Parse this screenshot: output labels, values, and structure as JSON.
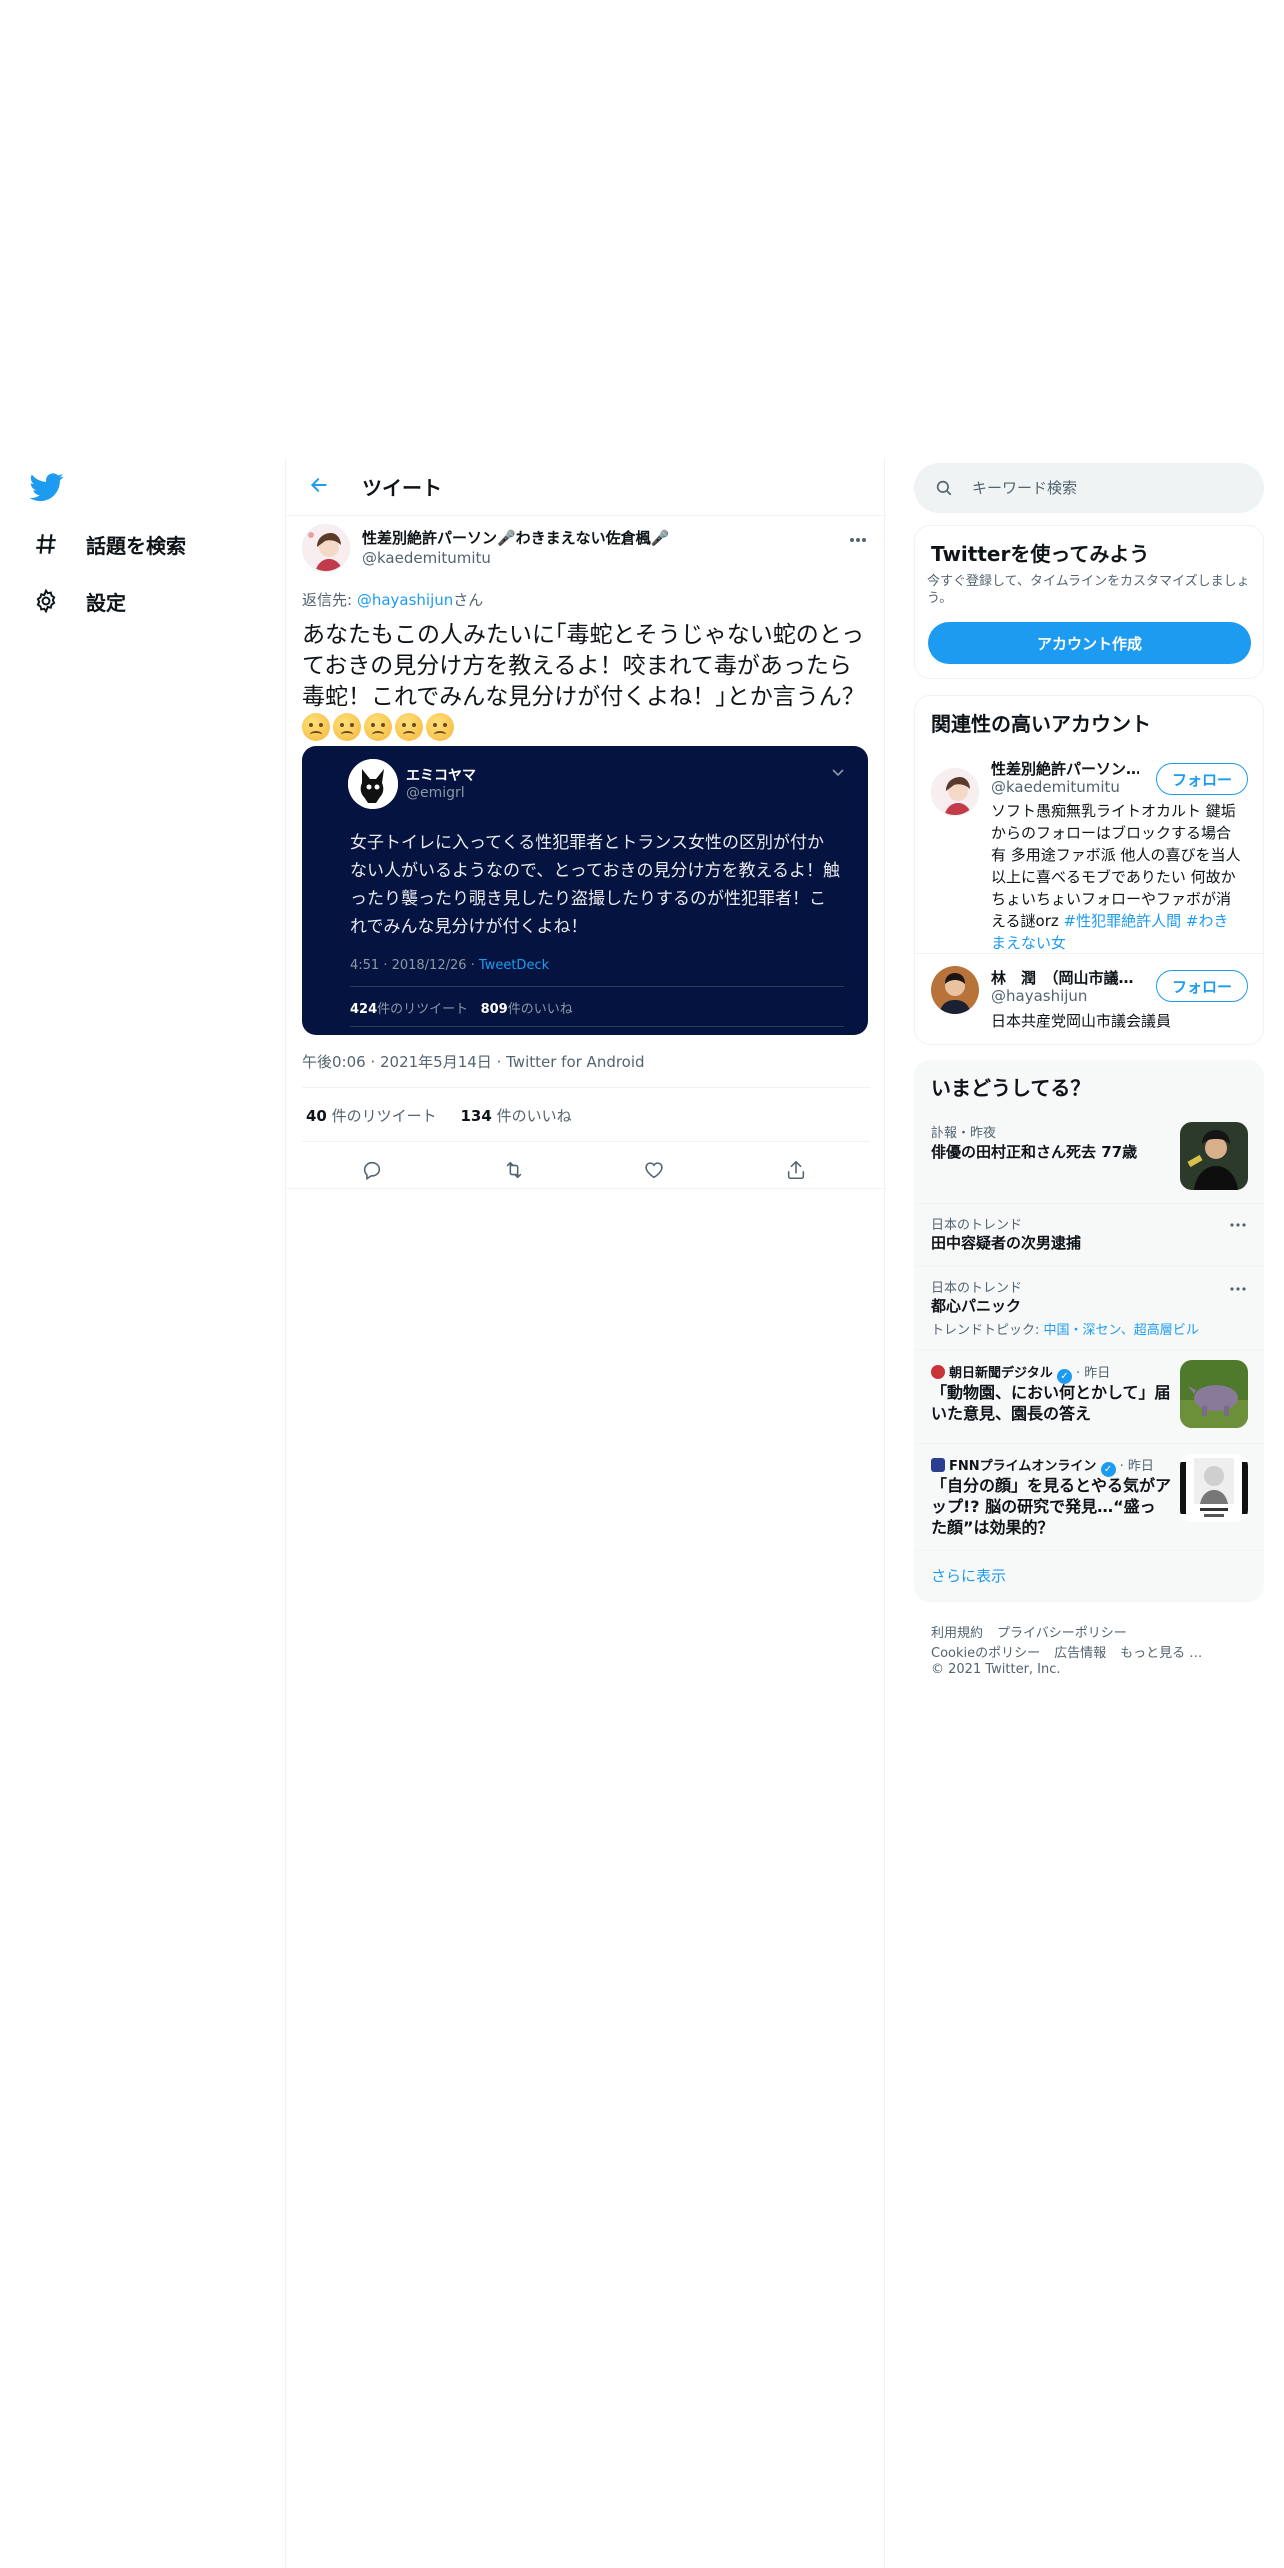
{
  "colors": {
    "accent": "#1d9bf0",
    "quote_bg": "#051340",
    "text": "#0f1419",
    "secondary": "#536471"
  },
  "nav": {
    "logo_icon": "twitter-bird-icon",
    "items": [
      {
        "label": "話題を検索",
        "icon": "hashtag-icon"
      },
      {
        "label": "設定",
        "icon": "gear-icon"
      }
    ]
  },
  "header": {
    "title": "ツイート",
    "back_icon": "arrow-left-icon"
  },
  "tweet": {
    "author_name": "性差別絶許パーソン🎤わきまえない佐倉楓🎤",
    "author_handle": "@kaedemitumitu",
    "reply_prefix": "返信先: ",
    "reply_to": "@hayashijun",
    "reply_suffix": "さん",
    "text": "あなたもこの人みたいに｢毒蛇とそうじゃない蛇のとっておきの見分け方を教えるよ！咬まれて毒があったら毒蛇！これでみんな見分けが付くよね！｣とか言うん？",
    "emoji_count": 5,
    "time": "午後0:06",
    "date": "2021年5月14日",
    "source": "Twitter for Android",
    "retweets": "40",
    "retweets_label": " 件のリツイート",
    "likes": "134",
    "likes_label": " 件のいいね"
  },
  "quote": {
    "name": "エミコヤマ",
    "handle": "@emigrl",
    "text": "女子トイレに入ってくる性犯罪者とトランス女性の区別が付かない人がいるようなので、とっておきの見分け方を教えるよ！触ったり襲ったり覗き見したり盗撮したりするのが性犯罪者！これでみんな見分けが付くよね！",
    "time": "4:51 · 2018/12/26 · ",
    "client": "TweetDeck",
    "retweets": "424",
    "retweets_label": "件のリツイート",
    "likes": "809",
    "likes_label": "件のいいね"
  },
  "search": {
    "placeholder": "キーワード検索"
  },
  "signup": {
    "title": "Twitterを使ってみよう",
    "desc": "今すぐ登録して、タイムラインをカスタマイズしましょう。",
    "button": "アカウント作成"
  },
  "accounts": {
    "title": "関連性の高いアカウント",
    "follow_label": "フォロー",
    "list": [
      {
        "name": "性差別絶許パーソン…",
        "handle": "@kaedemitumitu",
        "bio": "ソフト愚痴無乳ライトオカルト 鍵垢からのフォローはブロックする場合有 多用途ファボ派 他人の喜びを当人以上に喜べるモブでありたい 何故かちょいちょいフォローやファボが消える謎orz ",
        "tags": "#性犯罪絶許人間 #わきまえない女"
      },
      {
        "name": "林　潤　（岡山市議…",
        "handle": "@hayashijun",
        "bio": "日本共産党岡山市議会議員"
      }
    ]
  },
  "trends": {
    "title": "いまどうしてる？",
    "items": [
      {
        "context": "訃報・昨夜",
        "title": "俳優の田村正和さん死去 77歳"
      },
      {
        "context": "日本のトレンド",
        "title": "田中容疑者の次男逮捕"
      },
      {
        "context": "日本のトレンド",
        "title": "都心パニック",
        "sub_prefix": "トレンドトピック: ",
        "sub_links": "中国・深セン、超高層ビル"
      },
      {
        "source": "朝日新聞デジタル",
        "when": " · 昨日",
        "title": "「動物園、におい何とかして」届いた意見、園長の答え"
      },
      {
        "source": "FNNプライムオンライン",
        "when": " · 昨日",
        "title": "「自分の顔」を見るとやる気がアップ!? 脳の研究で発見…“盛った顔”は効果的？"
      }
    ],
    "show_more": "さらに表示"
  },
  "footer": {
    "links1": [
      "利用規約",
      "プライバシーポリシー"
    ],
    "links2": [
      "Cookieのポリシー",
      "広告情報",
      "もっと見る …"
    ],
    "copyright": "© 2021 Twitter, Inc."
  }
}
